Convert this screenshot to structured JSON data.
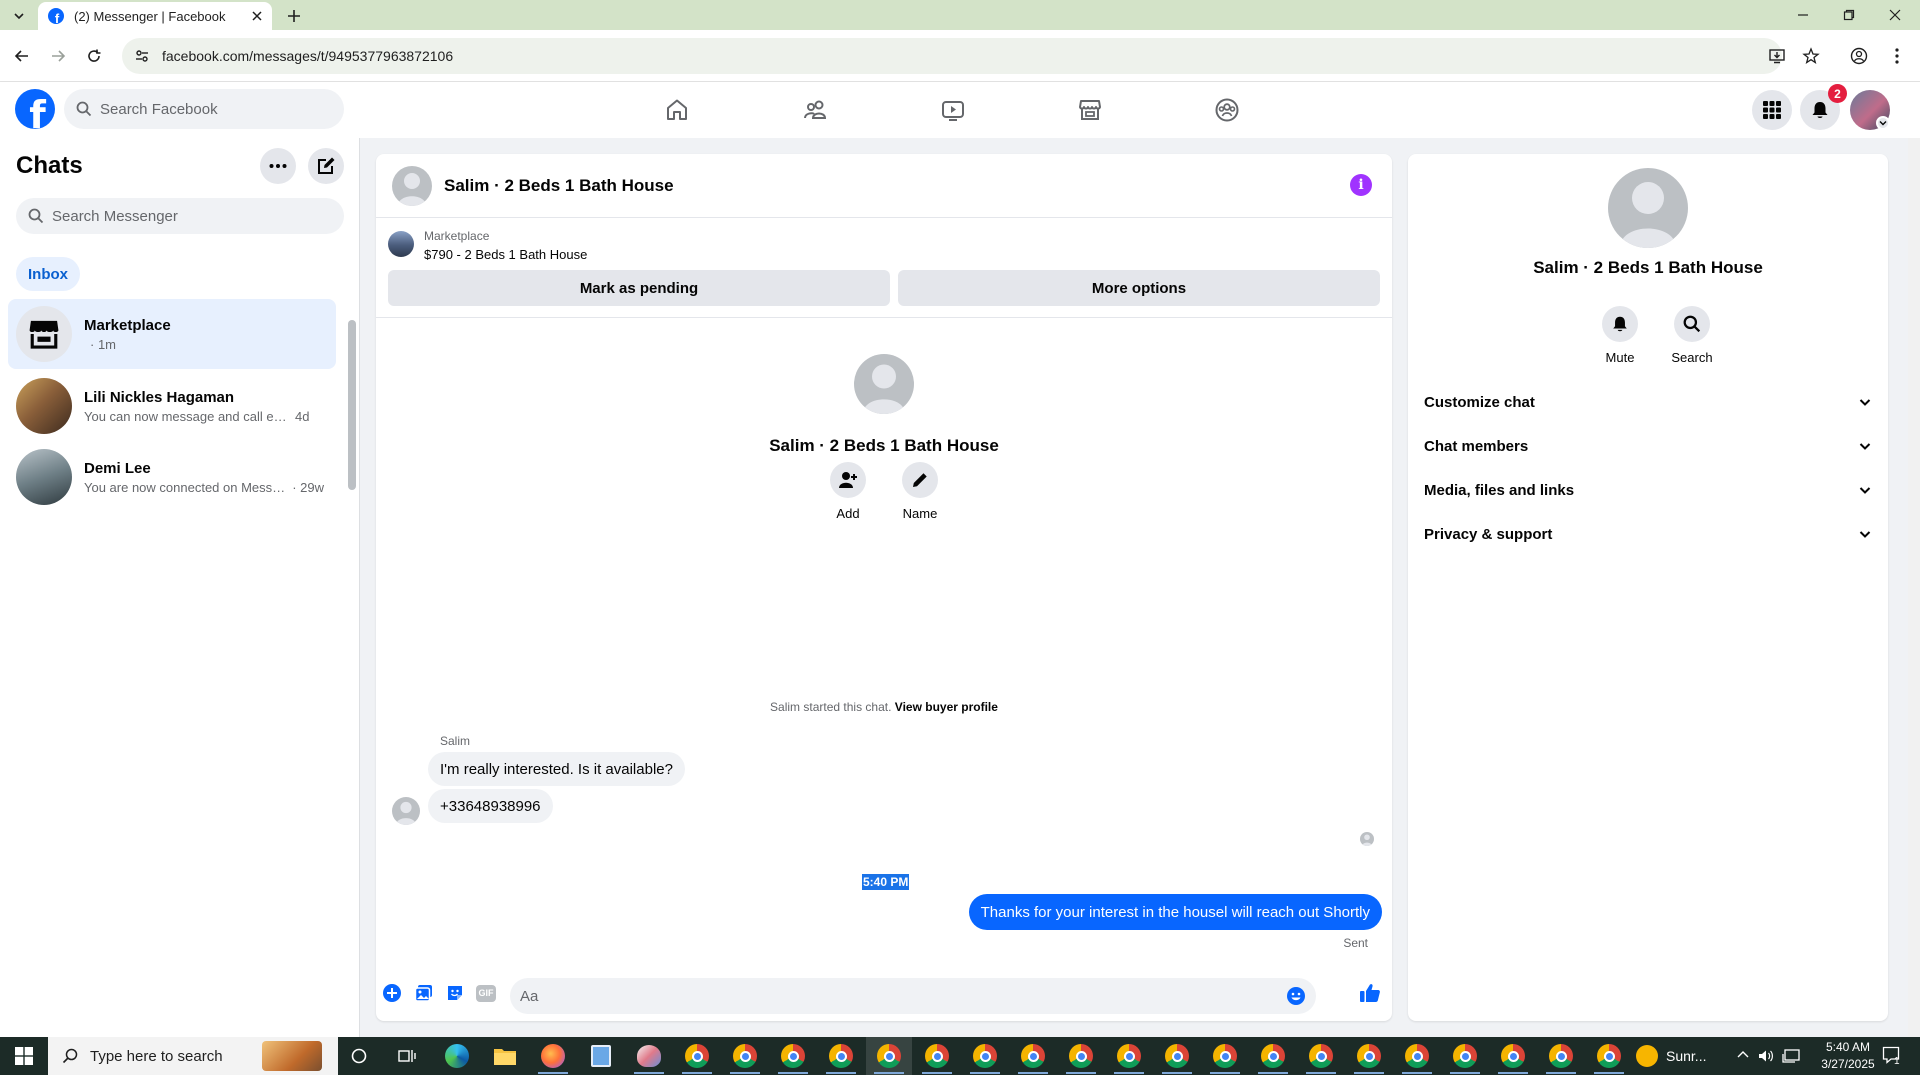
{
  "browser": {
    "tab_title": "(2) Messenger | Facebook",
    "url": "facebook.com/messages/t/9495377963872106"
  },
  "fb_header": {
    "search_placeholder": "Search Facebook",
    "notification_count": "2"
  },
  "chats": {
    "title": "Chats",
    "search_placeholder": "Search Messenger",
    "filter_active": "Inbox",
    "items": [
      {
        "name": "Marketplace",
        "preview": "",
        "time": "· 1m"
      },
      {
        "name": "Lili Nickles Hagaman",
        "preview": "You can now message and call eac...",
        "time": "4d"
      },
      {
        "name": "Demi Lee",
        "preview": "You are now connected on Messe...",
        "time": "· 29w"
      }
    ]
  },
  "conversation": {
    "title": "Salim · 2 Beds 1 Bath House",
    "listing_source": "Marketplace",
    "listing_title": "$790 - 2 Beds 1 Bath House",
    "mark_pending_label": "Mark as pending",
    "more_options_label": "More options",
    "intro_name": "Salim · 2 Beds 1 Bath House",
    "add_label": "Add",
    "name_label": "Name",
    "started_text": "Salim started this chat.",
    "view_profile_link": "View buyer profile",
    "sender": "Salim",
    "incoming": [
      "I'm really interested. Is it available?",
      "+33648938996"
    ],
    "timestamp": "5:40 PM",
    "outgoing": "Thanks for your interest in the housel will reach out Shortly",
    "sent_status": "Sent",
    "composer_placeholder": "Aa"
  },
  "info_panel": {
    "name": "Salim · 2 Beds 1 Bath House",
    "mute_label": "Mute",
    "search_label": "Search",
    "sections": [
      "Customize chat",
      "Chat members",
      "Media, files and links",
      "Privacy & support"
    ]
  },
  "taskbar": {
    "search_placeholder": "Type here to search",
    "weather": "Sunr...",
    "time": "5:40 AM",
    "date": "3/27/2025",
    "notification_count": "1"
  },
  "colors": {
    "facebook_blue": "#0866ff",
    "tab_strip": "#d3e3c8",
    "info_purple": "#a033ff",
    "notification_red": "#e41e3f"
  }
}
